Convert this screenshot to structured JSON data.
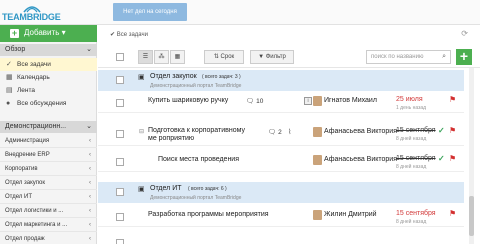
{
  "brand": {
    "logo_text": "TEAMBRIDGE"
  },
  "header": {
    "no_tasks_label": "Нет дел на сегодня"
  },
  "sidebar": {
    "add_label": "Добавить ▾",
    "overview_title": "Обзор",
    "nav": [
      {
        "label": "Все задачи",
        "icon": "check-icon"
      },
      {
        "label": "Календарь",
        "icon": "calendar-icon"
      },
      {
        "label": "Лента",
        "icon": "feed-icon"
      },
      {
        "label": "Все обсуждения",
        "icon": "chat-icon"
      }
    ],
    "portal_title": "Демонстрационн...",
    "departments": [
      {
        "label": "Администрация"
      },
      {
        "label": "Внедрение ERP"
      },
      {
        "label": "Корпоратив"
      },
      {
        "label": "Отдел закупок"
      },
      {
        "label": "Отдел ИТ"
      },
      {
        "label": "Отдел логистики и ..."
      },
      {
        "label": "Отдел маркетинга и ..."
      },
      {
        "label": "Отдел продаж"
      }
    ]
  },
  "main": {
    "breadcrumb": "Все задачи",
    "toolbar": {
      "deadline_label": "Срок",
      "filter_label": "Фильтр",
      "search_placeholder": "поиск по названию"
    },
    "groups": [
      {
        "name": "Отдел закупок",
        "count_label": "( всего задач: 3 )",
        "subtitle": "Демонстрационный портал TeamBridge"
      },
      {
        "name": "Отдел ИТ",
        "count_label": "( всего задач: 6 )",
        "subtitle": "Демонстрационный портал TeamBridge"
      }
    ],
    "tasks": [
      {
        "title": "Купить шариковую ручку",
        "comments": "10",
        "user": "Игнатов Михаил",
        "date": "25 июля",
        "ago": "1 день назад",
        "struck": false,
        "done": false
      },
      {
        "title": "Подготовка к корпоративному ме роприятию",
        "comments": "2",
        "user": "Афанасьева Виктория",
        "date": "15 сентября",
        "ago": "8 дней назад",
        "struck": true,
        "done": true
      },
      {
        "title": "Поиск места проведения",
        "comments": "",
        "user": "Афанасьева Виктория",
        "date": "15 сентября",
        "ago": "8 дней назад",
        "struck": true,
        "done": true
      },
      {
        "title": "Разработка программы мероприятия",
        "comments": "",
        "user": "Жилин Дмитрий",
        "date": "15 сентября",
        "ago": "8 дней назад",
        "struck": false,
        "done": false
      }
    ]
  },
  "colors": {
    "accent_green": "#4caf50",
    "group_bg": "#dbe9f6",
    "overdue_red": "#d23a3a",
    "active_nav": "#fff7d1"
  }
}
